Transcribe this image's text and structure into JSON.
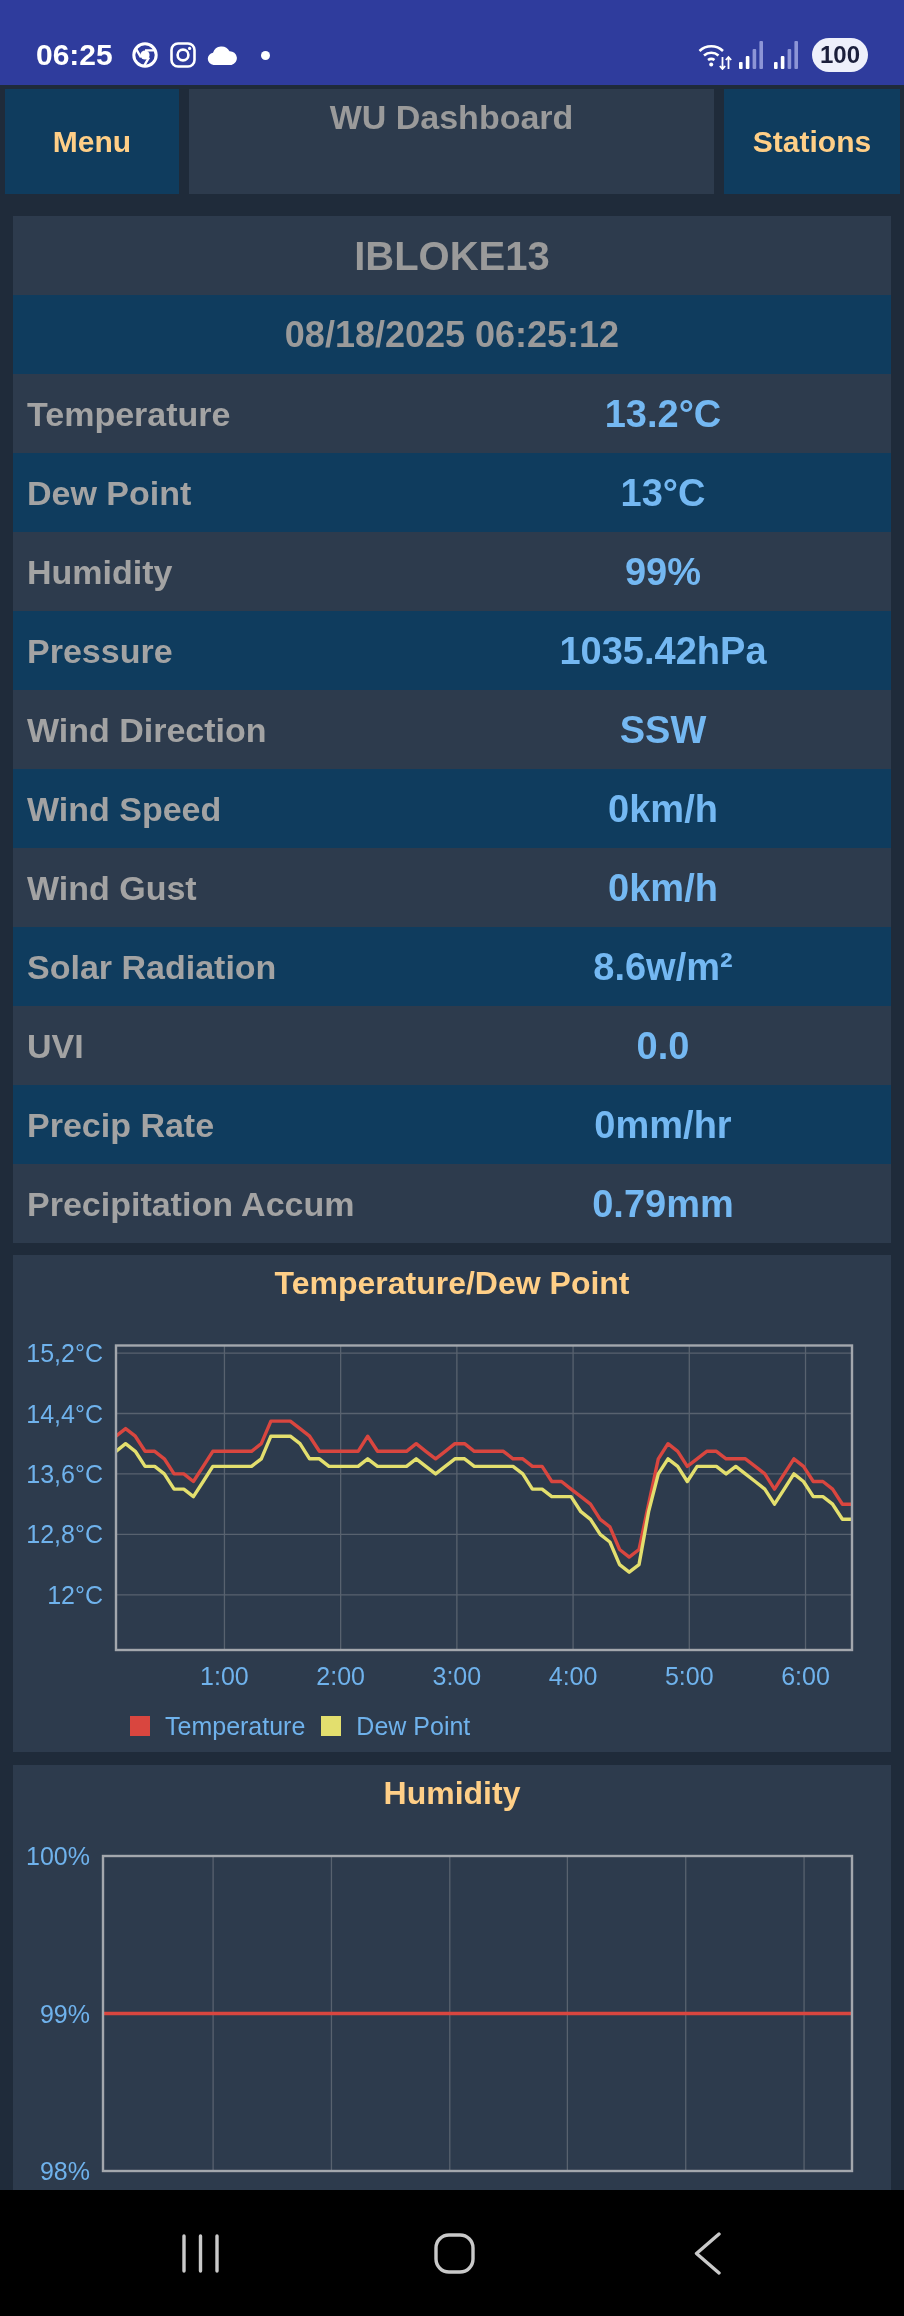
{
  "status_bar": {
    "time": "06:25",
    "battery": "100"
  },
  "header": {
    "menu_button": "Menu",
    "title": "WU Dashboard",
    "stations_button": "Stations"
  },
  "station": {
    "id": "IBLOKE13",
    "updated": "08/18/2025 06:25:12",
    "readings": [
      {
        "label": "Temperature",
        "value": "13.2°C"
      },
      {
        "label": "Dew Point",
        "value": "13°C"
      },
      {
        "label": "Humidity",
        "value": "99%"
      },
      {
        "label": "Pressure",
        "value": "1035.42hPa"
      },
      {
        "label": "Wind Direction",
        "value": "SSW"
      },
      {
        "label": "Wind Speed",
        "value": "0km/h"
      },
      {
        "label": "Wind Gust",
        "value": "0km/h"
      },
      {
        "label": "Solar Radiation",
        "value": "8.6w/m²"
      },
      {
        "label": "UVI",
        "value": "0.0"
      },
      {
        "label": "Precip Rate",
        "value": "0mm/hr"
      },
      {
        "label": "Precipitation Accum",
        "value": "0.79mm"
      }
    ]
  },
  "charts": [
    {
      "chart_data": {
        "type": "line",
        "title": "Temperature/Dew Point",
        "x": [
          0.067,
          0.15,
          0.233,
          0.317,
          0.4,
          0.483,
          0.567,
          0.65,
          0.733,
          0.817,
          0.9,
          0.983,
          1.067,
          1.15,
          1.233,
          1.317,
          1.4,
          1.483,
          1.567,
          1.65,
          1.733,
          1.817,
          1.9,
          1.983,
          2.067,
          2.15,
          2.233,
          2.317,
          2.4,
          2.483,
          2.567,
          2.65,
          2.733,
          2.817,
          2.9,
          2.983,
          3.067,
          3.15,
          3.233,
          3.317,
          3.4,
          3.483,
          3.567,
          3.65,
          3.733,
          3.817,
          3.9,
          3.983,
          4.067,
          4.15,
          4.233,
          4.317,
          4.4,
          4.483,
          4.567,
          4.65,
          4.733,
          4.817,
          4.9,
          4.983,
          5.067,
          5.15,
          5.233,
          5.317,
          5.4,
          5.483,
          5.567,
          5.65,
          5.733,
          5.817,
          5.9,
          5.983,
          6.067,
          6.15,
          6.233,
          6.317,
          6.4
        ],
        "series": [
          {
            "name": "Temperature",
            "color": "#d9463f",
            "values": [
              14.1,
              14.2,
              14.1,
              13.9,
              13.9,
              13.8,
              13.6,
              13.6,
              13.5,
              13.7,
              13.9,
              13.9,
              13.9,
              13.9,
              13.9,
              14.0,
              14.3,
              14.3,
              14.3,
              14.2,
              14.1,
              13.9,
              13.9,
              13.9,
              13.9,
              13.9,
              14.1,
              13.9,
              13.9,
              13.9,
              13.9,
              14.0,
              13.9,
              13.8,
              13.9,
              14.0,
              14.0,
              13.9,
              13.9,
              13.9,
              13.9,
              13.8,
              13.8,
              13.7,
              13.7,
              13.5,
              13.5,
              13.4,
              13.3,
              13.2,
              13.0,
              12.9,
              12.6,
              12.5,
              12.6,
              13.2,
              13.8,
              14.0,
              13.9,
              13.7,
              13.8,
              13.9,
              13.9,
              13.8,
              13.8,
              13.8,
              13.7,
              13.6,
              13.4,
              13.6,
              13.8,
              13.7,
              13.5,
              13.5,
              13.4,
              13.2,
              13.2
            ]
          },
          {
            "name": "Dew Point",
            "color": "#e3df6e",
            "values": [
              13.9,
              14.0,
              13.9,
              13.7,
              13.7,
              13.6,
              13.4,
              13.4,
              13.3,
              13.5,
              13.7,
              13.7,
              13.7,
              13.7,
              13.7,
              13.8,
              14.1,
              14.1,
              14.1,
              14.0,
              13.8,
              13.8,
              13.7,
              13.7,
              13.7,
              13.7,
              13.8,
              13.7,
              13.7,
              13.7,
              13.7,
              13.8,
              13.7,
              13.6,
              13.7,
              13.8,
              13.8,
              13.7,
              13.7,
              13.7,
              13.7,
              13.7,
              13.6,
              13.4,
              13.4,
              13.3,
              13.3,
              13.3,
              13.1,
              13.0,
              12.8,
              12.7,
              12.4,
              12.3,
              12.4,
              13.1,
              13.6,
              13.8,
              13.7,
              13.5,
              13.7,
              13.7,
              13.7,
              13.6,
              13.7,
              13.6,
              13.5,
              13.4,
              13.2,
              13.4,
              13.6,
              13.5,
              13.3,
              13.3,
              13.2,
              13.0,
              13.0
            ]
          }
        ],
        "xlim": [
          0.067,
          6.4
        ],
        "ylim": [
          11.27,
          15.3
        ],
        "xticks": [
          {
            "value": 1,
            "label": "1:00"
          },
          {
            "value": 2,
            "label": "2:00"
          },
          {
            "value": 3,
            "label": "3:00"
          },
          {
            "value": 4,
            "label": "4:00"
          },
          {
            "value": 5,
            "label": "5:00"
          },
          {
            "value": 6,
            "label": "6:00"
          }
        ],
        "yticks": [
          {
            "value": 12,
            "label": "12°C"
          },
          {
            "value": 12.8,
            "label": "12,8°C"
          },
          {
            "value": 13.6,
            "label": "13,6°C"
          },
          {
            "value": 14.4,
            "label": "14,4°C"
          },
          {
            "value": 15.2,
            "label": "15,2°C"
          }
        ],
        "grid": true,
        "legend": true
      }
    },
    {
      "chart_data": {
        "type": "line",
        "title": "Humidity",
        "series": [
          {
            "color": "#d9463f",
            "values": [
              99,
              99,
              99,
              99,
              99,
              99,
              99,
              99,
              99,
              99,
              99,
              99,
              99,
              99,
              99,
              99,
              99,
              99,
              99,
              99,
              99,
              99,
              99,
              99,
              99,
              99,
              99,
              99,
              99,
              99,
              99,
              99,
              99,
              99,
              99,
              99,
              99,
              99,
              99,
              99,
              99,
              99,
              99,
              99,
              99,
              99,
              99,
              99,
              99,
              99,
              99,
              99,
              99,
              99,
              99,
              99,
              99,
              99,
              99,
              99,
              99,
              99,
              99,
              99,
              99,
              99,
              99,
              99,
              99,
              99,
              99,
              99,
              99,
              99,
              99,
              99,
              99
            ]
          }
        ],
        "ylim": [
          98,
          100
        ],
        "yticks": [
          {
            "value": 98,
            "label": "98%"
          },
          {
            "value": 99,
            "label": "99%"
          },
          {
            "value": 100,
            "label": "100%"
          }
        ],
        "grid": true
      }
    }
  ]
}
